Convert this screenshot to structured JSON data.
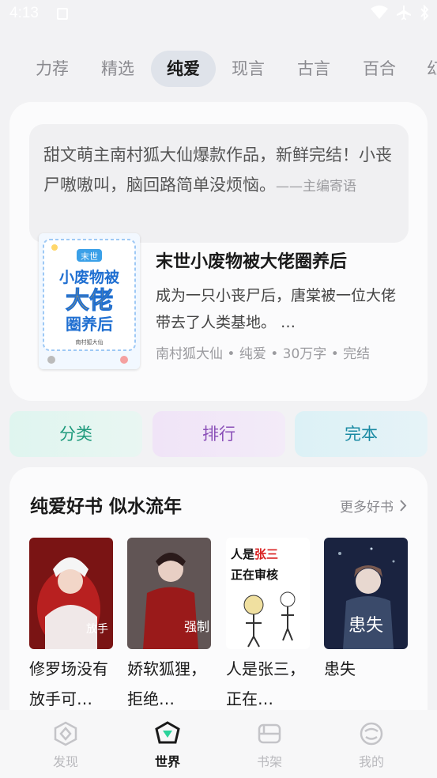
{
  "status_bar": {
    "time": "4:13"
  },
  "tabs": [
    "力荐",
    "精选",
    "纯爱",
    "现言",
    "古言",
    "百合",
    "幻"
  ],
  "active_tab": "纯爱",
  "featured": {
    "quote": "甜文萌主南村狐大仙爆款作品，新鲜完结！小丧尸嗷嗷叫，脑回路简单没烦恼。",
    "quote_sign": "——主编寄语",
    "book_title": "末世小废物被大佬圈养后",
    "description": "成为一只小丧尸后，唐棠被一位大佬带去了人类基地。 …",
    "meta": "南村狐大仙 • 纯爱 • 30万字 • 完结",
    "cover_text": {
      "small": "末世",
      "line1": "小废物被",
      "line2": "大佬",
      "line3": "圈养后",
      "author": "南村狐大仙"
    }
  },
  "quick_links": {
    "category": "分类",
    "ranking": "排行",
    "complete": "完本"
  },
  "recommend": {
    "title": "纯爱好书 似水流年",
    "more": "更多好书",
    "books": [
      {
        "title": "修罗场没有放手可…",
        "cover_text": "放手"
      },
      {
        "title": "娇软狐狸，拒绝…",
        "cover_text": "强制"
      },
      {
        "title": "人是张三，正在…",
        "cover_text": "人是张三正在审核"
      },
      {
        "title": "患失",
        "cover_text": "患失"
      }
    ]
  },
  "bottom_nav": [
    {
      "label": "发现",
      "icon": "discover-icon",
      "active": false
    },
    {
      "label": "世界",
      "icon": "world-icon",
      "active": true
    },
    {
      "label": "书架",
      "icon": "bookshelf-icon",
      "active": false
    },
    {
      "label": "我的",
      "icon": "profile-icon",
      "active": false
    }
  ],
  "colors": {
    "accent_green": "#1e9a7c",
    "accent_purple": "#8a4fb8",
    "accent_teal": "#1a8aa3",
    "active_tab_bg": "#dfe3ea"
  }
}
